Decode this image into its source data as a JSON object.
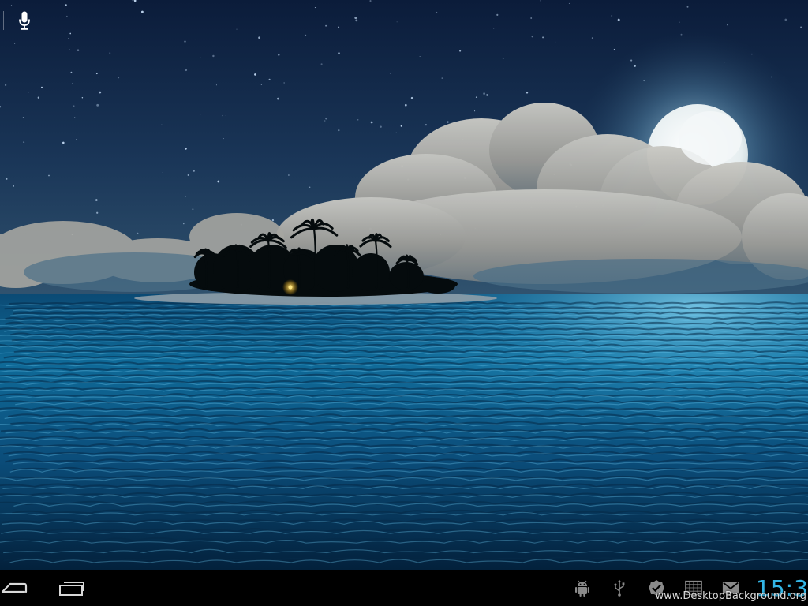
{
  "wallpaper": {
    "sky_top": "#0c1e3d",
    "sky_horizon": "#30526e",
    "sea_top": "#0f5f8e",
    "sea_bottom": "#04243f",
    "moon": "#eef4f6",
    "moon_glow": "#9fd0e8",
    "cloud": "#9a9a96",
    "island": "#050b0d",
    "light": "#ffd24a"
  },
  "top_bar": {
    "voice_search_icon": "microphone-icon"
  },
  "system_bar": {
    "back_icon": "back-arrow-icon",
    "recent_apps_icon": "recent-apps-icon",
    "status_icons": [
      "android-debug-icon",
      "usb-icon",
      "checkmark-icon",
      "calendar-grid-icon",
      "gmail-icon"
    ],
    "clock": "15:3",
    "clock_color": "#33b5e5",
    "watermark": "www.DesktopBackground.org"
  }
}
